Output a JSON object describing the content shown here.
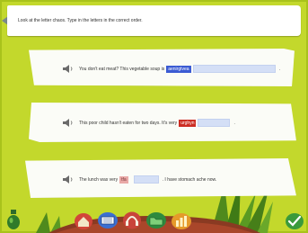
{
  "instruction": "Look at the letter chaos. Type in the letters in the correct order.",
  "sentences": [
    {
      "before": "You don't eat meat? This vegetable soup is",
      "chaos": "aenirgtvea",
      "answer": "",
      "after": "."
    },
    {
      "before": "This poor child hasn't eaten for two days. It's very",
      "chaos": "urghyn",
      "answer": "",
      "after": "."
    },
    {
      "before": "The lunch was very",
      "chaos": "tfa",
      "answer": "",
      "after": ". I have stomach ache now."
    }
  ],
  "colors": {
    "background": "#c3d82c",
    "frame": "#a9c21b",
    "chaos_blue": "#3b5bd3",
    "chaos_red": "#cc2d23",
    "chaos_pink": "#e9a9a7",
    "answer_box": "#d4dff6",
    "toolbar_brown": "#8a3a22"
  },
  "toolbar": {
    "icons": [
      "home-icon",
      "keyboard-icon",
      "headphones-icon",
      "folder-icon",
      "score-chart-icon"
    ],
    "left_icon": "bottle-icon",
    "right_icon": "check-icon"
  }
}
